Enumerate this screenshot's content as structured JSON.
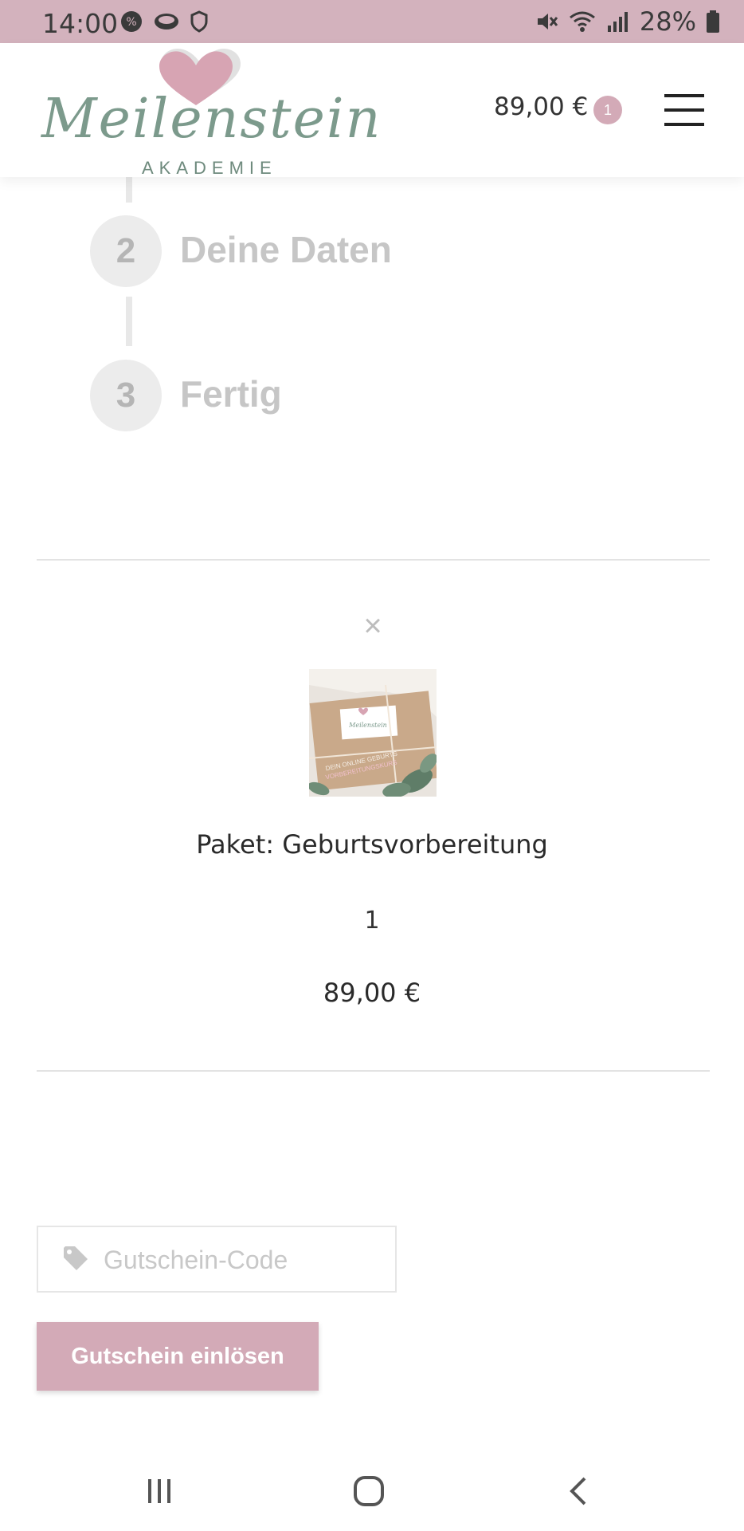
{
  "status_bar": {
    "time": "14:00",
    "battery": "28%",
    "icons": [
      "notification-badge-icon",
      "cloud-icon",
      "shield-icon",
      "mute-icon",
      "wifi-icon",
      "signal-icon",
      "battery-icon"
    ]
  },
  "header": {
    "logo_script": "Meilenstein",
    "logo_sub": "AKADEMIE",
    "cart_total": "89,00 €",
    "cart_count": "1",
    "menu_icon": "hamburger-icon"
  },
  "steps": [
    {
      "number": "2",
      "label": "Deine Daten"
    },
    {
      "number": "3",
      "label": "Fertig"
    }
  ],
  "cart_item": {
    "remove_symbol": "×",
    "name": "Paket: Geburtsvorbereitung",
    "quantity": "1",
    "price": "89,00 €"
  },
  "coupon": {
    "placeholder": "Gutschein-Code",
    "button_label": "Gutschein einlösen"
  },
  "colors": {
    "accent": "#d3aab7",
    "status_bar": "#d3b2bd",
    "logo_green": "#7c9a8c"
  },
  "nav_bar": {
    "icons": [
      "recent-apps-icon",
      "home-icon",
      "back-icon"
    ]
  }
}
